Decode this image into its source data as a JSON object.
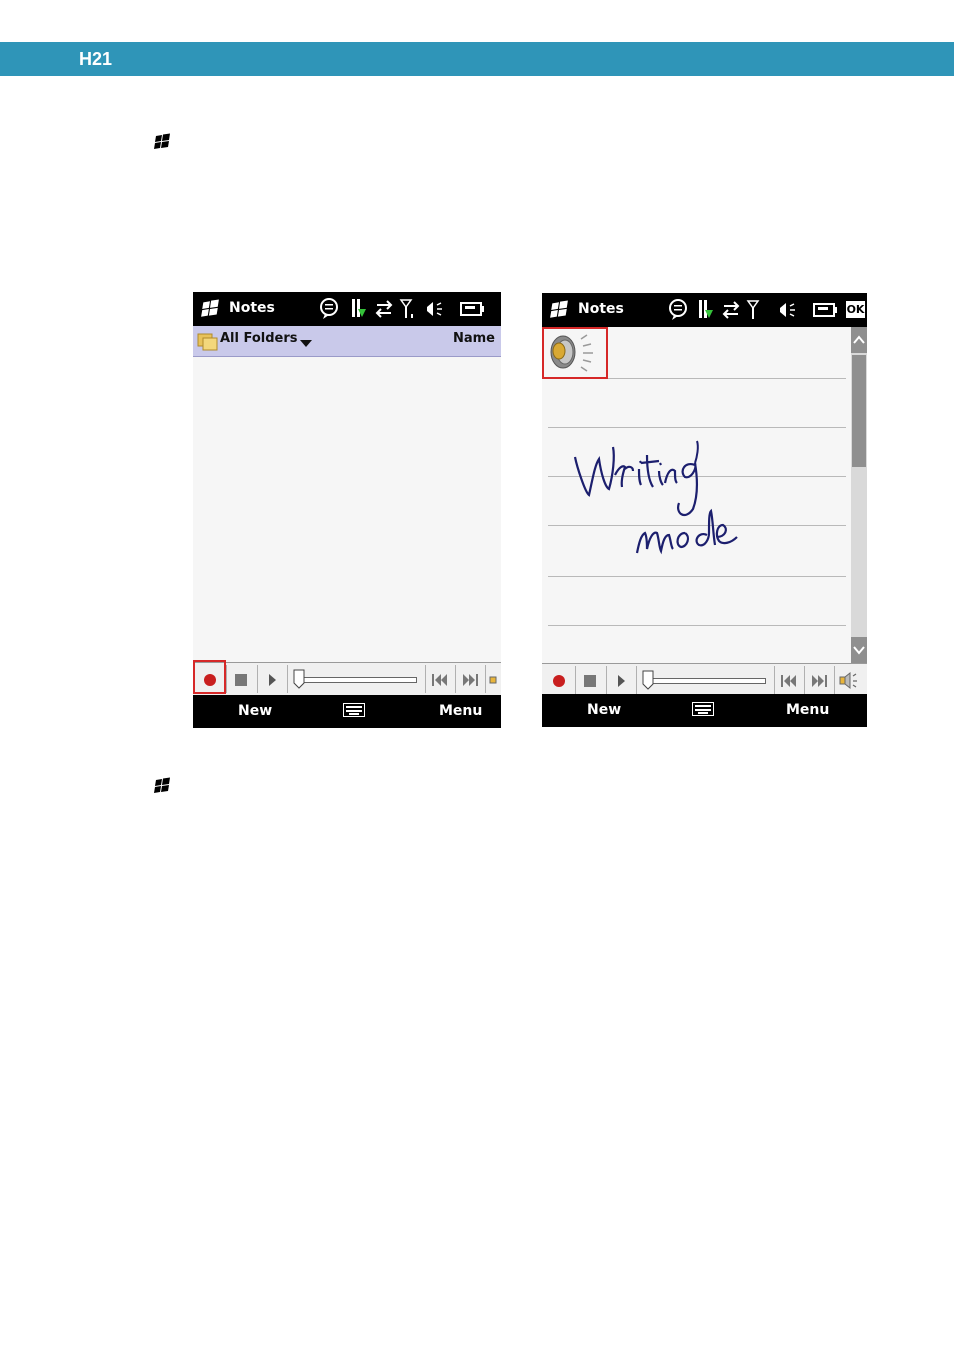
{
  "header": {
    "title": "H21",
    "color": "#2f95b8"
  },
  "bullets": [
    {
      "icon": "windows-logo-icon"
    },
    {
      "icon": "windows-logo-icon"
    }
  ],
  "screen_left": {
    "app_title": "Notes",
    "folders_label": "All Folders",
    "sort_label": "Name",
    "soft_left": "New",
    "soft_right": "Menu",
    "highlight": "record-button"
  },
  "screen_right": {
    "app_title": "Notes",
    "ok_label": "OK",
    "soft_left": "New",
    "soft_right": "Menu",
    "handwriting": [
      "Writing",
      "mode"
    ],
    "highlight": "voice-note-icon"
  },
  "colors": {
    "accent": "#2f95b8",
    "highlight": "#d62828",
    "ink": "#1c1f6e"
  }
}
